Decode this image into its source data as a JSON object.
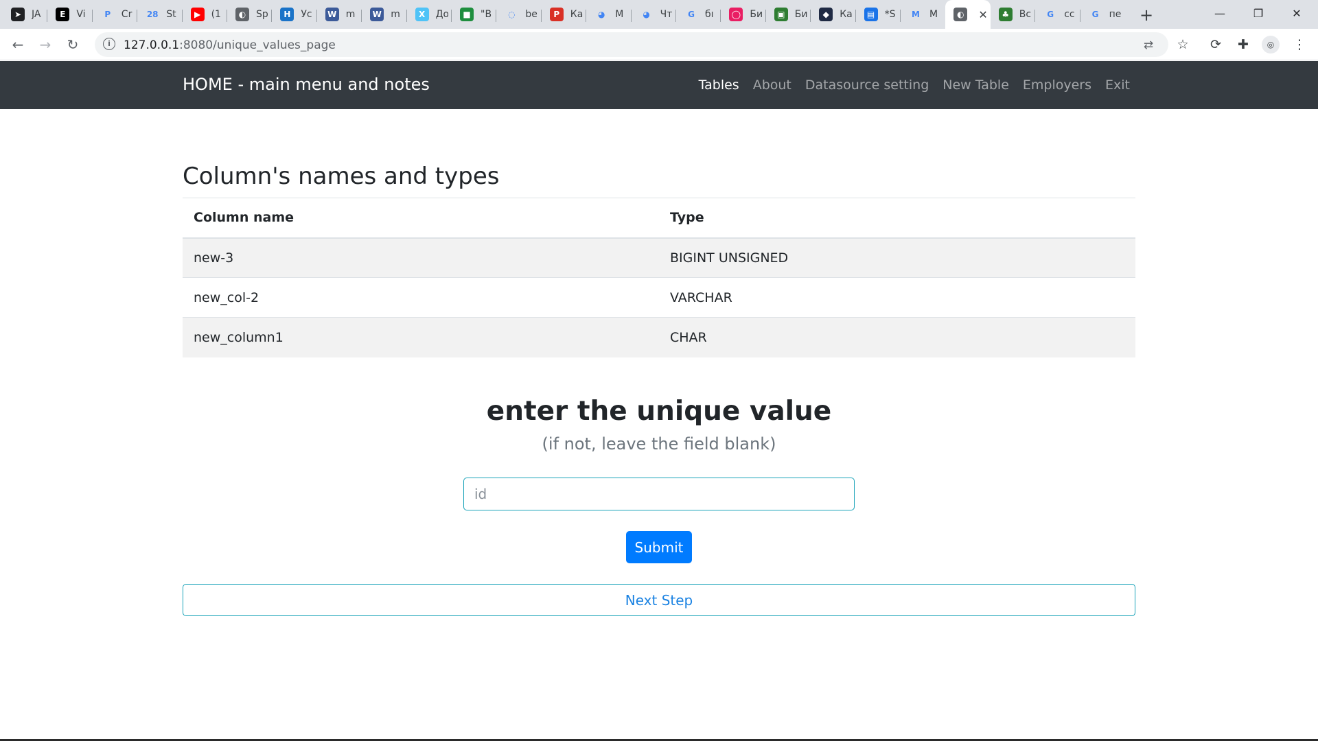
{
  "browser": {
    "tabs": [
      {
        "label": "JA",
        "icon": "arrow-circle-icon",
        "color": "#202124",
        "glyph": "➤"
      },
      {
        "label": "Vi",
        "icon": "letter-e-icon",
        "color": "#000000",
        "glyph": "E"
      },
      {
        "label": "Cr",
        "icon": "letter-p-icon",
        "color": "#ffffff",
        "glyph": "P"
      },
      {
        "label": "St",
        "icon": "calendar-icon",
        "color": "#ffffff",
        "glyph": "28"
      },
      {
        "label": "(1",
        "icon": "youtube-icon",
        "color": "#ff0000",
        "glyph": "▶"
      },
      {
        "label": "Sp",
        "icon": "globe-icon",
        "color": "#5f6368",
        "glyph": "◐"
      },
      {
        "label": "Ус",
        "icon": "hexlet-icon",
        "color": "#1a73c8",
        "glyph": "H"
      },
      {
        "label": "m",
        "icon": "wordpress-icon",
        "color": "#3c5a99",
        "glyph": "W"
      },
      {
        "label": "m",
        "icon": "wordpress-icon",
        "color": "#3c5a99",
        "glyph": "W"
      },
      {
        "label": "До",
        "icon": "circle-app-icon",
        "color": "#4fc3f7",
        "glyph": "X"
      },
      {
        "label": "\"В",
        "icon": "puzzle-app-icon",
        "color": "#1e8e3e",
        "glyph": "■"
      },
      {
        "label": "be",
        "icon": "spinner-icon",
        "color": "#ffffff",
        "glyph": "◌"
      },
      {
        "label": "Ка",
        "icon": "pdf-icon",
        "color": "#d93025",
        "glyph": "P"
      },
      {
        "label": "M",
        "icon": "bird-icon",
        "color": "#ffffff",
        "glyph": "◕"
      },
      {
        "label": "Чт",
        "icon": "bird-icon",
        "color": "#ffffff",
        "glyph": "◕"
      },
      {
        "label": "бı",
        "icon": "google-icon",
        "color": "#ffffff",
        "glyph": "G"
      },
      {
        "label": "Би",
        "icon": "ring-icon",
        "color": "#e91e63",
        "glyph": "◯"
      },
      {
        "label": "Би",
        "icon": "colorful-app-icon",
        "color": "#2e7d32",
        "glyph": "▣"
      },
      {
        "label": "Ка",
        "icon": "square-app-icon",
        "color": "#1f2a44",
        "glyph": "◆"
      },
      {
        "label": "*S",
        "icon": "chat-icon",
        "color": "#1a73e8",
        "glyph": "▤"
      },
      {
        "label": "M",
        "icon": "gmail-icon",
        "color": "#ffffff",
        "glyph": "M"
      },
      {
        "label": "",
        "icon": "globe-icon",
        "color": "#5f6368",
        "glyph": "◐"
      },
      {
        "label": "Вс",
        "icon": "leaf-icon",
        "color": "#2e7d32",
        "glyph": "♣"
      },
      {
        "label": "cc",
        "icon": "google-icon",
        "color": "#ffffff",
        "glyph": "G"
      },
      {
        "label": "пе",
        "icon": "google-icon",
        "color": "#ffffff",
        "glyph": "G"
      }
    ],
    "active_tab_index": 21,
    "url_host": "127.0.0.1",
    "url_path": ":8080/unique_values_page"
  },
  "navbar": {
    "brand": "HOME - main menu and notes",
    "links": [
      "Tables",
      "About",
      "Datasource setting",
      "New Table",
      "Employers",
      "Exit"
    ]
  },
  "columns_section": {
    "title": "Column's names and types",
    "headers": [
      "Column name",
      "Type"
    ],
    "rows": [
      [
        "new-3",
        "BIGINT UNSIGNED"
      ],
      [
        "new_col-2",
        "VARCHAR"
      ],
      [
        "new_column1",
        "CHAR"
      ]
    ]
  },
  "form": {
    "title": "enter the unique value",
    "subtitle": "(if not, leave the field blank)",
    "input_placeholder": "id",
    "input_value": "",
    "submit_label": "Submit",
    "next_label": "Next Step"
  }
}
